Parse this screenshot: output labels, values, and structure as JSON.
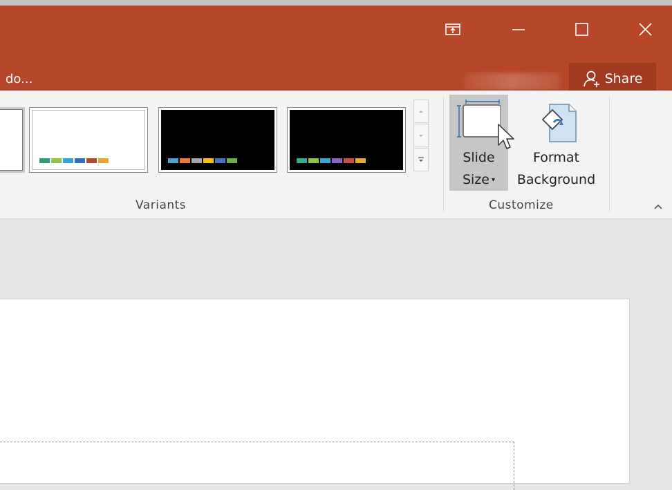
{
  "window": {
    "tell_me_text": "do...",
    "share_label": "Share",
    "controls": [
      "ribbon-display-options",
      "minimize",
      "maximize",
      "close"
    ]
  },
  "colors": {
    "title_bar": "#b7472a",
    "share_button": "#a13a20",
    "ribbon_bg": "#f3f3f3",
    "workspace_bg": "#e6e6e6"
  },
  "ribbon": {
    "variants": {
      "label": "Variants",
      "thumbnails": [
        {
          "background": "white",
          "colors": []
        },
        {
          "background": "white",
          "colors": [
            "#2e9e78",
            "#8dc63f",
            "#2fa6d9",
            "#2c6fbf",
            "#b7472a",
            "#f0a32c"
          ]
        },
        {
          "background": "black",
          "colors": [
            "#4f9fd8",
            "#ec7c30",
            "#a5a5a5",
            "#ffc000",
            "#4472c4",
            "#70ad47"
          ]
        },
        {
          "background": "black",
          "colors": [
            "#2eaf90",
            "#8cc63f",
            "#31a6d9",
            "#8764c8",
            "#c8503a",
            "#e8a92c"
          ]
        }
      ]
    },
    "customize": {
      "label": "Customize",
      "slide_size": {
        "line1": "Slide",
        "line2": "Size"
      },
      "format_background": {
        "line1": "Format",
        "line2": "Background"
      }
    }
  }
}
